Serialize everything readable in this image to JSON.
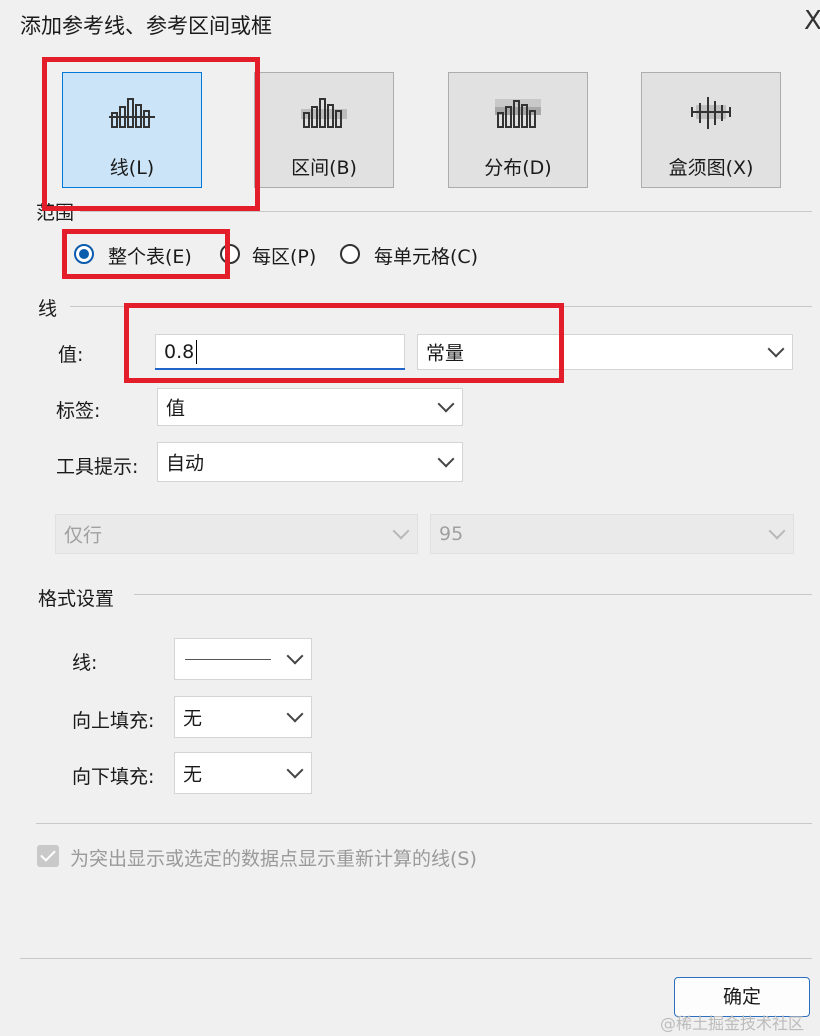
{
  "window": {
    "title": "添加参考线、参考区间或框",
    "close_glyph": "X"
  },
  "type_buttons": [
    {
      "label": "线(L)",
      "icon": "line-chart-icon",
      "selected": true
    },
    {
      "label": "区间(B)",
      "icon": "band-chart-icon",
      "selected": false
    },
    {
      "label": "分布(D)",
      "icon": "distribution-chart-icon",
      "selected": false
    },
    {
      "label": "盒须图(X)",
      "icon": "box-plot-icon",
      "selected": false
    }
  ],
  "scope": {
    "section_label": "范围",
    "options": [
      {
        "label": "整个表(E)",
        "checked": true
      },
      {
        "label": "每区(P)",
        "checked": false
      },
      {
        "label": "每单元格(C)",
        "checked": false
      }
    ]
  },
  "line": {
    "section_label": "线",
    "value_label": "值:",
    "value_input": "0.8",
    "value_type": "常量",
    "label_label": "标签:",
    "label_value": "值",
    "tooltip_label": "工具提示:",
    "tooltip_value": "自动",
    "disabled_left": "仅行",
    "disabled_right": "95"
  },
  "format": {
    "section_label": "格式设置",
    "line_label": "线:",
    "fill_above_label": "向上填充:",
    "fill_above_value": "无",
    "fill_below_label": "向下填充:",
    "fill_below_value": "无"
  },
  "recalc_checkbox": {
    "label": "为突出显示或选定的数据点显示重新计算的线(S)",
    "checked": true
  },
  "ok_button": "确定",
  "watermark": "@稀土掘金技术社区",
  "colors": {
    "accent": "#0078d7",
    "highlight": "#e31e2a",
    "selected_bg": "#cce4f7"
  }
}
